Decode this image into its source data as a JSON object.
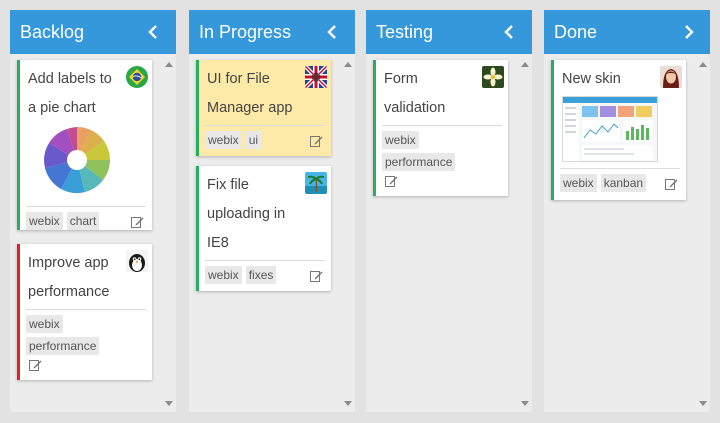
{
  "columns": [
    {
      "title": "Backlog",
      "chevron": "chevron-left-icon",
      "cards": [
        {
          "title": "Add labels to a pie chart",
          "tags": [
            "webix",
            "chart"
          ],
          "avatar": "brazil-flag-avatar"
        },
        {
          "title": "Improve app performance",
          "tags": [
            "webix",
            "performance"
          ],
          "avatar": "penguin-avatar"
        }
      ]
    },
    {
      "title": "In Progress",
      "chevron": "chevron-left-icon",
      "cards": [
        {
          "title": "UI for File Manager app",
          "tags": [
            "webix",
            "ui"
          ],
          "avatar": "uk-flag-avatar"
        },
        {
          "title": "Fix file uploading in IE8",
          "tags": [
            "webix",
            "fixes"
          ],
          "avatar": "palm-beach-avatar"
        }
      ]
    },
    {
      "title": "Testing",
      "chevron": "chevron-left-icon",
      "cards": [
        {
          "title": "Form validation",
          "tags": [
            "webix",
            "performance"
          ],
          "avatar": "flower-avatar"
        }
      ]
    },
    {
      "title": "Done",
      "chevron": "chevron-right-icon",
      "cards": [
        {
          "title": "New skin",
          "tags": [
            "webix",
            "kanban"
          ],
          "avatar": "woman-avatar"
        }
      ]
    }
  ],
  "colors": {
    "header": "#3498db",
    "green_border": "#27ae60",
    "red_border": "#e81c24",
    "yellow_card": "#fdeaa8"
  }
}
